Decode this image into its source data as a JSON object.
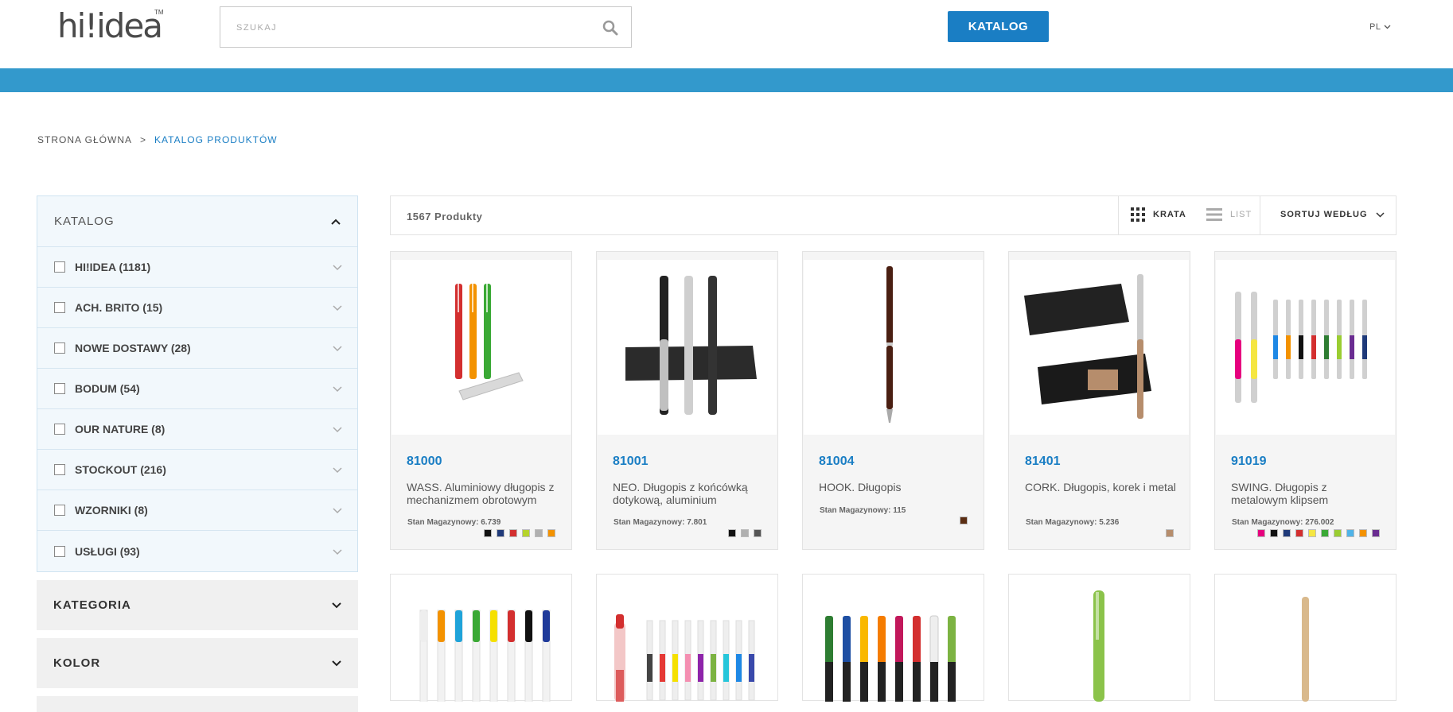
{
  "header": {
    "logo": "hi!idea",
    "logo_tm": "TM",
    "search_placeholder": "SZUKAJ",
    "catalog_button": "KATALOG",
    "language": "PL"
  },
  "breadcrumb": {
    "home": "STRONA GŁÓWNA",
    "separator": ">",
    "current": "KATALOG PRODUKTÓW"
  },
  "sidebar": {
    "catalog_title": "KATALOG",
    "items": [
      {
        "label": "HI!IDEA (1181)"
      },
      {
        "label": "ACH. BRITO (15)"
      },
      {
        "label": "NOWE DOSTAWY (28)"
      },
      {
        "label": "BODUM (54)"
      },
      {
        "label": "OUR NATURE (8)"
      },
      {
        "label": "STOCKOUT (216)"
      },
      {
        "label": "WZORNIKI (8)"
      },
      {
        "label": "USŁUGI (93)"
      }
    ],
    "groups": [
      {
        "label": "KATEGORIA"
      },
      {
        "label": "KOLOR"
      }
    ]
  },
  "toolbar": {
    "count": "1567 Produkty",
    "grid_label": "KRATA",
    "list_label": "LIST",
    "sort_label": "SORTUJ WEDŁUG"
  },
  "products": [
    {
      "code": "81000",
      "name": "WASS. Aluminiowy długopis z mechanizmem obrotowym",
      "stock": "Stan Magazynowy: 6.739",
      "swatches": [
        "#111111",
        "#1f3a7a",
        "#d32f2f",
        "#b5d32b",
        "#b0b0b0",
        "#f39200"
      ]
    },
    {
      "code": "81001",
      "name": "NEO. Długopis z końcówką dotykową, aluminium",
      "stock": "Stan Magazynowy: 7.801",
      "swatches": [
        "#111111",
        "#b0b0b0",
        "#555555"
      ]
    },
    {
      "code": "81004",
      "name": "HOOK. Długopis",
      "stock": "Stan Magazynowy: 115",
      "swatches": [
        "#5a2d12"
      ]
    },
    {
      "code": "81401",
      "name": "CORK. Długopis, korek i metal",
      "stock": "Stan Magazynowy: 5.236",
      "swatches": [
        "#b68d6c"
      ]
    },
    {
      "code": "91019",
      "name": "SWING. Długopis z metalowym klipsem",
      "stock": "Stan Magazynowy: 276.002",
      "swatches": [
        "#e6007e",
        "#111111",
        "#1f3a7a",
        "#d32f2f",
        "#f5e642",
        "#3aa935",
        "#9acd32",
        "#4fb3e8",
        "#f39200",
        "#6a2c91"
      ]
    }
  ]
}
